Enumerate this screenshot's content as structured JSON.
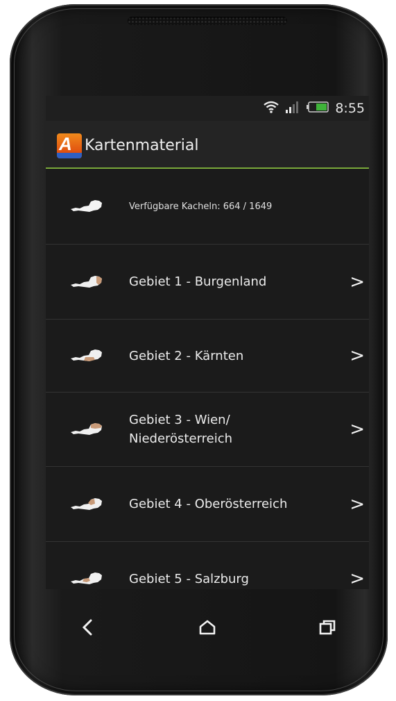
{
  "status": {
    "time": "8:55",
    "icons": [
      "wifi-icon",
      "signal-icon",
      "battery-icon"
    ]
  },
  "actionbar": {
    "app_icon": "app-logo-icon",
    "app_icon_letter": "A",
    "title": "Kartenmaterial"
  },
  "info": {
    "icon": "austria-map-icon",
    "label": "Verfügbare Kacheln: 664 / 1649"
  },
  "regions": [
    {
      "icon": "austria-map-burgenland-icon",
      "label": "Gebiet 1 - Burgenland",
      "chevron": ">"
    },
    {
      "icon": "austria-map-kaernten-icon",
      "label": "Gebiet 2 - Kärnten",
      "chevron": ">"
    },
    {
      "icon": "austria-map-wien-icon",
      "label_line1": "Gebiet 3 - Wien/",
      "label_line2": "Niederösterreich",
      "chevron": ">"
    },
    {
      "icon": "austria-map-oberoesterreich-icon",
      "label": "Gebiet 4 - Oberösterreich",
      "chevron": ">"
    },
    {
      "icon": "austria-map-salzburg-icon",
      "label": "Gebiet 5 - Salzburg",
      "chevron": ">"
    }
  ],
  "navbar": {
    "icons": [
      "back-icon",
      "home-icon",
      "recent-apps-icon"
    ]
  },
  "colors": {
    "accent": "#7aa93a",
    "background": "#1b1b1b",
    "app_icon_orange": "#e25410",
    "app_icon_blue": "#2f5fc1",
    "map_highlight": "#c89a78"
  }
}
